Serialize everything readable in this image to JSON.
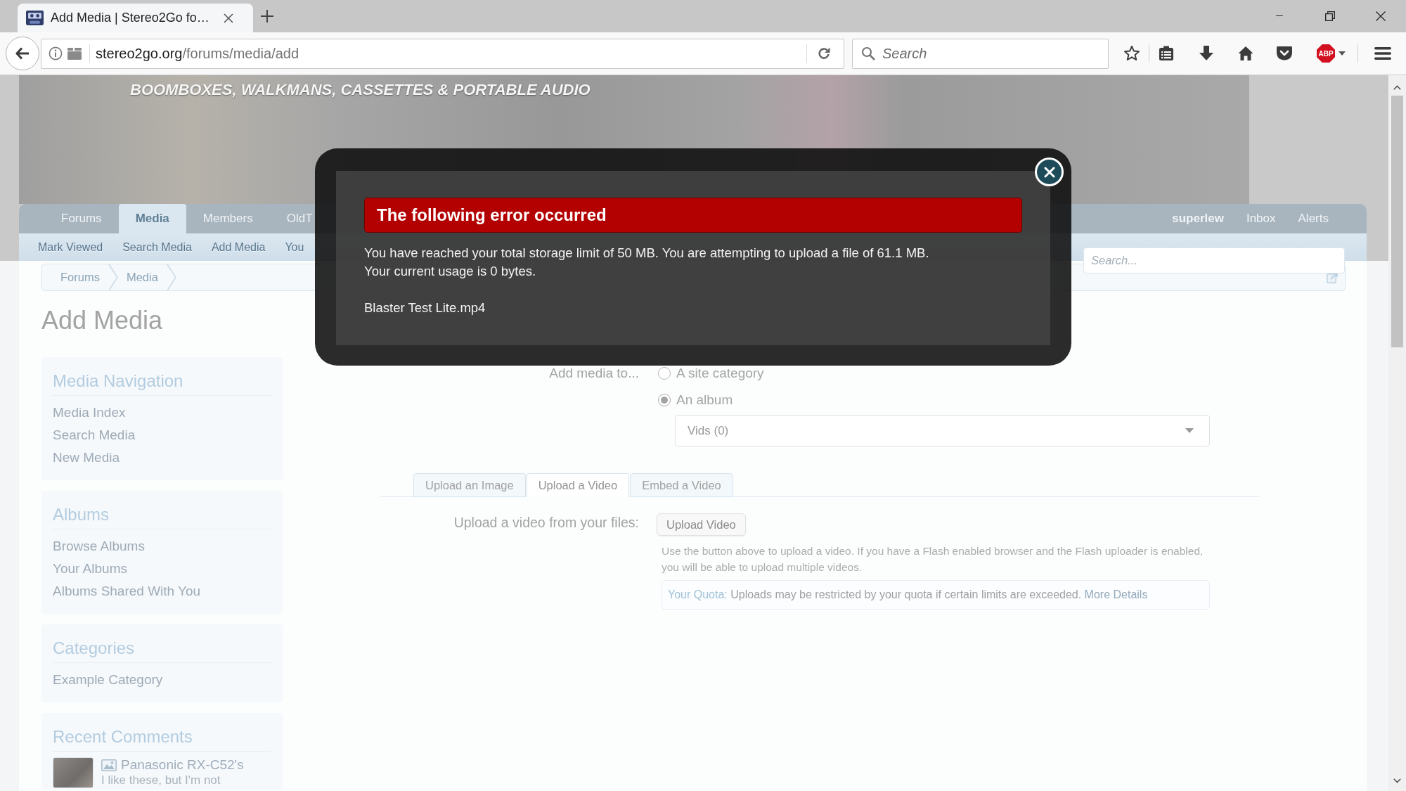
{
  "browser": {
    "tab_title": "Add Media | Stereo2Go fo…",
    "url": {
      "host": "stereo2go.org",
      "path": "/forums/media/add"
    },
    "search_placeholder": "Search",
    "adblock_label": "ABP"
  },
  "header": {
    "tagline": "BOOMBOXES, WALKMANS, CASSETTES & PORTABLE AUDIO"
  },
  "nav": {
    "tabs": [
      {
        "label": "Forums",
        "selected": false
      },
      {
        "label": "Media",
        "selected": true
      },
      {
        "label": "Members",
        "selected": false
      },
      {
        "label": "OldT",
        "selected": false
      }
    ],
    "user_links": [
      {
        "label": "superlew",
        "kind": "user"
      },
      {
        "label": "Inbox",
        "kind": "link"
      },
      {
        "label": "Alerts",
        "kind": "link"
      }
    ]
  },
  "subnav": {
    "items": [
      "Mark Viewed",
      "Search Media",
      "Add Media",
      "You"
    ],
    "search": {
      "placeholder": "Search..."
    }
  },
  "breadcrumb": [
    "Forums",
    "Media"
  ],
  "page_title": "Add Media",
  "sidebar": [
    {
      "title": "Media Navigation",
      "kind": "links",
      "items": [
        "Media Index",
        "Search Media",
        "New Media"
      ]
    },
    {
      "title": "Albums",
      "kind": "links",
      "items": [
        "Browse Albums",
        "Your Albums",
        "Albums Shared With You"
      ]
    },
    {
      "title": "Categories",
      "kind": "links",
      "items": [
        "Example Category"
      ]
    },
    {
      "title": "Recent Comments",
      "kind": "comments",
      "items": [
        {
          "title": "Panasonic RX-C52's",
          "excerpt": "I like these, but I'm not"
        }
      ]
    }
  ],
  "form": {
    "target_label": "Add media to...",
    "targets": [
      {
        "label": "A site category",
        "selected": false
      },
      {
        "label": "An album",
        "selected": true
      }
    ],
    "album_select": {
      "value": "Vids (0)"
    },
    "tabs": [
      {
        "label": "Upload an Image",
        "selected": false
      },
      {
        "label": "Upload a Video",
        "selected": true
      },
      {
        "label": "Embed a Video",
        "selected": false
      }
    ],
    "upload_label": "Upload a video from your files:",
    "upload_button": "Upload Video",
    "hint": "Use the button above to upload a video. If you have a Flash enabled browser and the Flash uploader is enabled, you will be able to upload multiple videos.",
    "quota": {
      "label": "Your Quota:",
      "text": "Uploads may be restricted by your quota if certain limits are exceeded.",
      "link": "More Details"
    }
  },
  "error_dialog": {
    "title": "The following error occurred",
    "message": [
      "You have reached your total storage limit of 50 MB. You are attempting to upload a file of 61.1 MB.",
      "Your current usage is 0 bytes."
    ],
    "file": "Blaster Test Lite.mp4"
  }
}
